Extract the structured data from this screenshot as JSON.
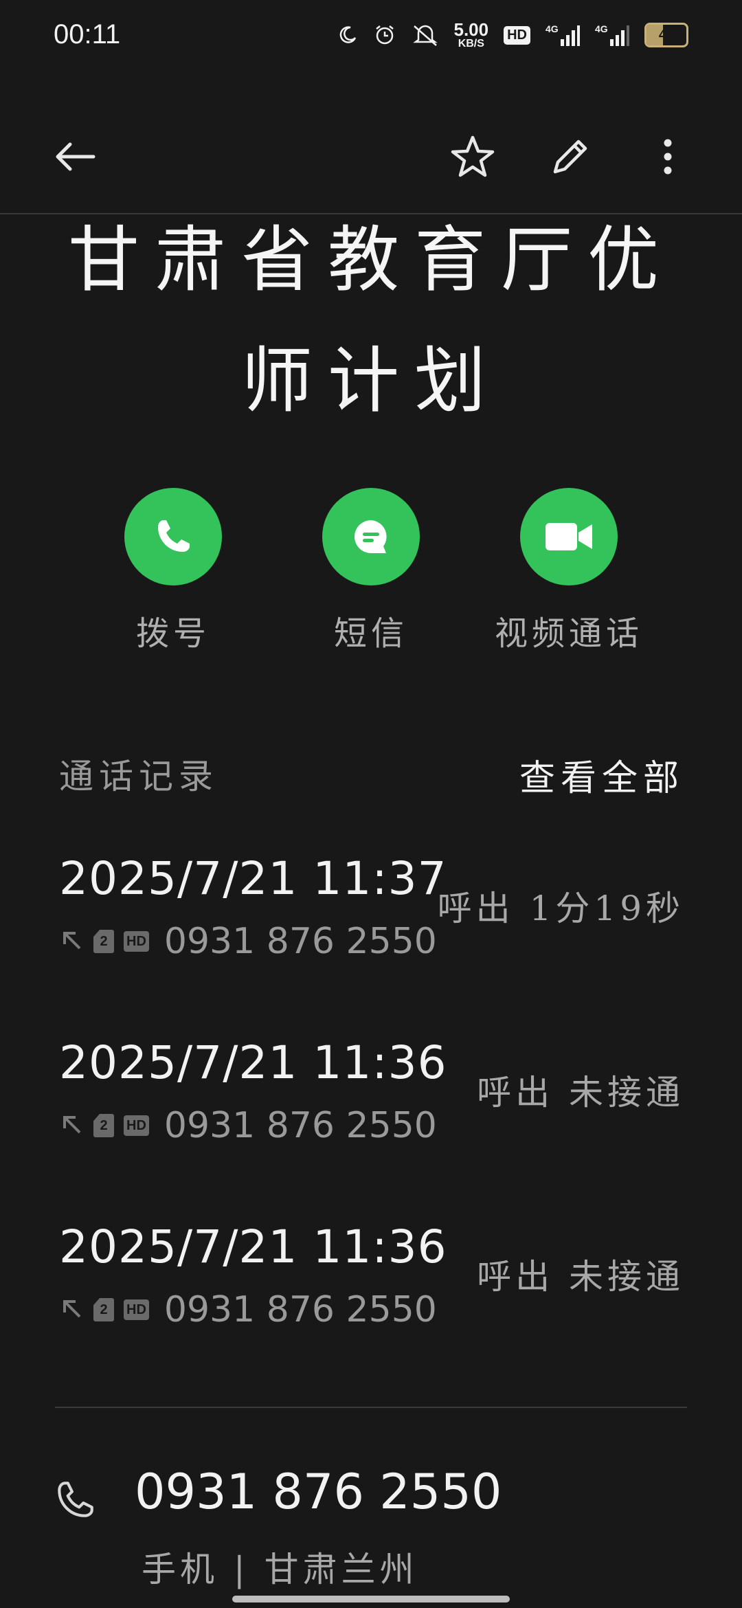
{
  "status_bar": {
    "time": "00:11",
    "net_speed_value": "5.00",
    "net_speed_unit": "KB/S",
    "hd_label": "HD",
    "signal_1_label": "4G",
    "signal_2_label": "4G",
    "battery_level": "42",
    "icons": [
      "moon-icon",
      "alarm-icon",
      "mute-icon",
      "hd-icon",
      "signal-icon",
      "signal-icon",
      "battery-icon"
    ]
  },
  "app_bar": {
    "icons": [
      "back-arrow-icon",
      "star-icon",
      "edit-pencil-icon",
      "more-vert-icon"
    ]
  },
  "contact": {
    "name": "甘肃省教育厅优师计划"
  },
  "actions": [
    {
      "label": "拨号",
      "icon": "phone-icon"
    },
    {
      "label": "短信",
      "icon": "message-icon"
    },
    {
      "label": "视频通话",
      "icon": "video-icon"
    }
  ],
  "call_log": {
    "title": "通话记录",
    "view_all": "查看全部",
    "entries": [
      {
        "datetime": "2025/7/21 11:37",
        "number": "0931 876 2550",
        "status": "呼出 1分19秒"
      },
      {
        "datetime": "2025/7/21 11:36",
        "number": "0931 876 2550",
        "status": "呼出 未接通"
      },
      {
        "datetime": "2025/7/21 11:36",
        "number": "0931 876 2550",
        "status": "呼出 未接通"
      }
    ]
  },
  "phone": {
    "number": "0931 876 2550",
    "description": "手机 | 甘肃兰州"
  },
  "colors": {
    "background": "#181818",
    "accent_green": "#34c25a",
    "text_primary": "#f2f2f2",
    "text_secondary": "#9a9a9a"
  }
}
